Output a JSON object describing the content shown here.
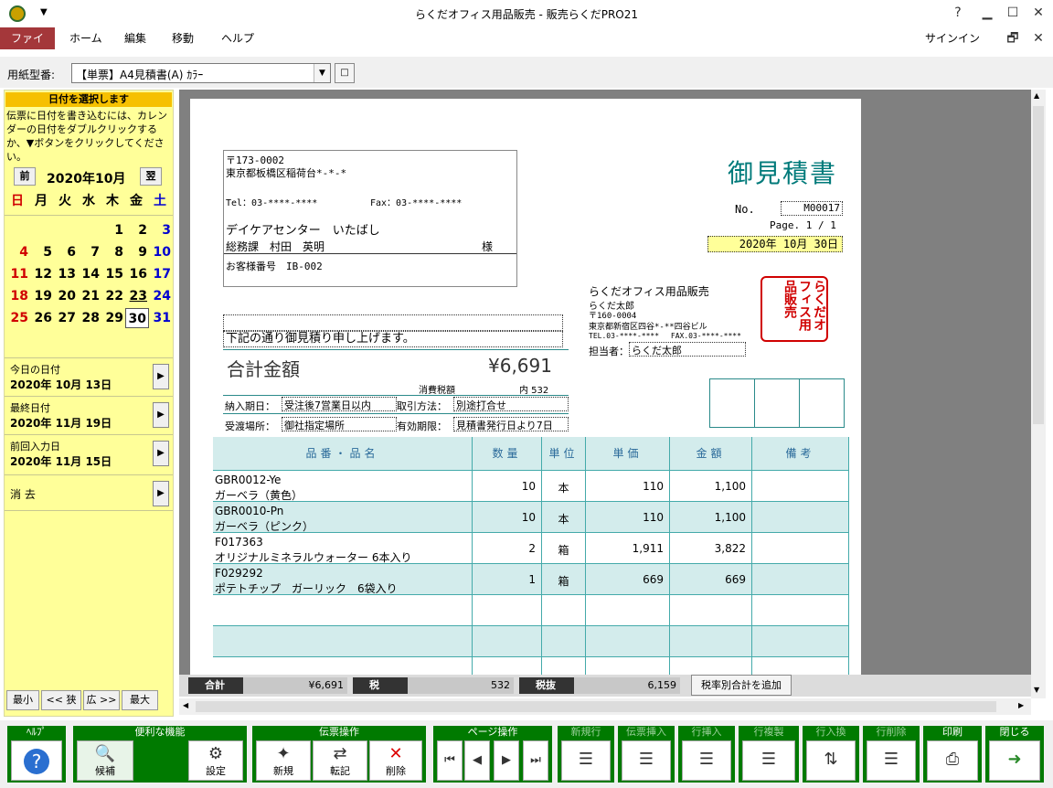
{
  "window": {
    "title": "らくだオフィス用品販売 - 販売らくだPRO21",
    "help": "?",
    "minimize": "▁",
    "maximize": "☐",
    "close": "✕",
    "qa_arrow": "▼"
  },
  "menu": {
    "items": [
      "ファイル",
      "ホーム",
      "編集",
      "移動",
      "ヘルプ"
    ],
    "signin": "サインイン",
    "restore": "🗗",
    "close": "✕"
  },
  "form": {
    "label": "用紙型番:",
    "selected": "【単票】A4見積書(A) ｶﾗｰ",
    "arrow": "▼",
    "side_button": "□"
  },
  "calendar": {
    "header": "日付を選択します",
    "description": "伝票に日付を書き込むには、カレンダーの日付をダブルクリックするか、▼ボタンをクリックしてください。",
    "prev": "前",
    "next": "翌",
    "month": "2020年10月",
    "weekdays": [
      "日",
      "月",
      "火",
      "水",
      "木",
      "金",
      "土"
    ],
    "weeks": [
      [
        "",
        "",
        "",
        "",
        "1",
        "2",
        "3"
      ],
      [
        "4",
        "5",
        "6",
        "7",
        "8",
        "9",
        "10"
      ],
      [
        "11",
        "12",
        "13",
        "14",
        "15",
        "16",
        "17"
      ],
      [
        "18",
        "19",
        "20",
        "21",
        "22",
        "23",
        "24"
      ],
      [
        "25",
        "26",
        "27",
        "28",
        "29",
        "30",
        "31"
      ]
    ],
    "today_label": "今日の日付",
    "today_value": "2020年 10月 13日",
    "last_label": "最終日付",
    "last_value": "2020年 11月 19日",
    "prev_label": "前回入力日",
    "prev_value": "2020年 11月 15日",
    "clear_label": "消 去",
    "arrow": "▶"
  },
  "zoom": {
    "min": "最小",
    "narrow": "<< 狭",
    "wide": "広 >>",
    "max": "最大"
  },
  "doc": {
    "title": "御見積書",
    "no_label": "No.",
    "no_value": "M00017",
    "page": "Page. 1 / 1",
    "date": "2020年 10月 30日",
    "customer": {
      "zip": "〒173-0002",
      "address": "東京都板橋区稲荷台*-*-*",
      "tel": "Tel：03-****-****",
      "fax": "Fax：03-****-****",
      "name": "デイケアセンター　いたばし",
      "dept": "総務課　村田　英明",
      "honorific": "様",
      "cust_no": "お客様番号　IB-002"
    },
    "company": {
      "name": "らくだオフィス用品販売",
      "person": "らくだ太郎",
      "zip": "〒160-0004",
      "address": "東京都新宿区四谷*-**四谷ビル",
      "telfax": "TEL.03-****-****　 FAX.03-****-****",
      "tanto_label": "担当者：",
      "tanto": "らくだ太郎",
      "seal": "らくだオフィス用品販売"
    },
    "greeting": "下記の通り御見積り申し上げます。",
    "total_label": "合計金額",
    "total_value": "¥6,691",
    "tax_label": "消費税額",
    "tax_value": "内 532",
    "delivery_label": "納入期日：",
    "delivery_value": "受注後7営業日以内",
    "method_label": "取引方法：",
    "method_value": "別途打合せ",
    "place_label": "受渡場所：",
    "place_value": "御社指定場所",
    "validity_label": "有効期限：",
    "validity_value": "見積書発行日より7日"
  },
  "table": {
    "headers": [
      "品番・品名",
      "数量",
      "単位",
      "単価",
      "金額",
      "備考"
    ],
    "rows": [
      {
        "code": "GBR0012-Ye",
        "name": "ガーベラ（黄色）",
        "qty": "10",
        "unit": "本",
        "price": "110",
        "amount": "1,100",
        "note": ""
      },
      {
        "code": "GBR0010-Pn",
        "name": "ガーベラ（ピンク）",
        "qty": "10",
        "unit": "本",
        "price": "110",
        "amount": "1,100",
        "note": ""
      },
      {
        "code": "F017363",
        "name": "オリジナルミネラルウォーター 6本入り",
        "qty": "2",
        "unit": "箱",
        "price": "1,911",
        "amount": "3,822",
        "note": ""
      },
      {
        "code": "F029292",
        "name": "ポテトチップ　ガーリック　6袋入り",
        "qty": "1",
        "unit": "箱",
        "price": "669",
        "amount": "669",
        "note": ""
      }
    ]
  },
  "totals": {
    "total_label": "合計",
    "total_value": "¥6,691",
    "tax_label": "税",
    "tax_value": "532",
    "excl_label": "税抜",
    "excl_value": "6,159",
    "add_button": "税率別合計を追加"
  },
  "toolbar": {
    "help": {
      "title": "ﾍﾙﾌﾟ",
      "icon": "?"
    },
    "tools": {
      "title": "便利な機能",
      "candidate": "候補",
      "settings": "設定"
    },
    "slip": {
      "title": "伝票操作",
      "new": "新規",
      "transfer": "転記",
      "delete": "削除"
    },
    "page": {
      "title": "ページ操作",
      "first": "⏮",
      "prev": "◀",
      "next": "▶",
      "last": "⏭"
    },
    "new_row": "新規行",
    "insert_slip": "伝票挿入",
    "insert_row": "行挿入",
    "copy_row": "行複製",
    "swap_row": "行入換",
    "delete_row": "行削除",
    "print": "印刷",
    "close": "閉じる"
  }
}
